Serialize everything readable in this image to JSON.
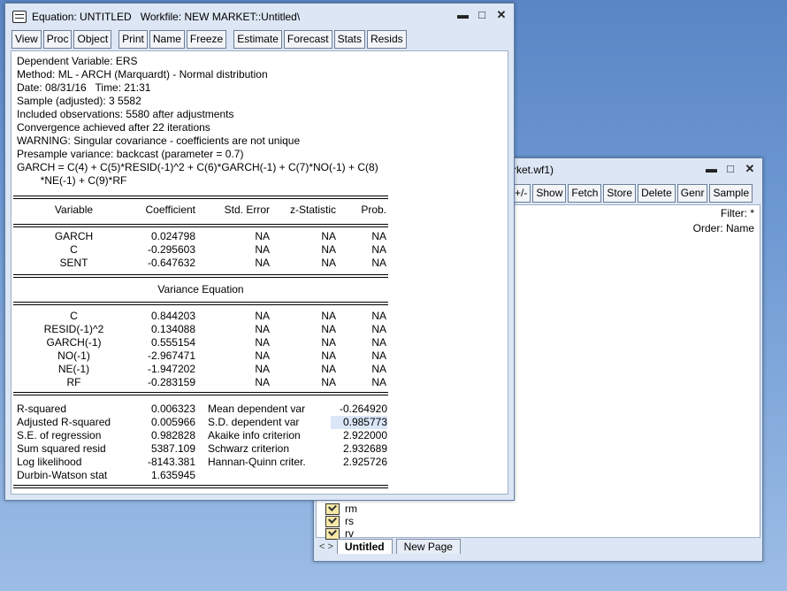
{
  "equation_window": {
    "title": "Equation: UNTITLED   Workfile: NEW MARKET::Untitled\\",
    "toolbar": [
      "View",
      "Proc",
      "Object",
      "Print",
      "Name",
      "Freeze",
      "Estimate",
      "Forecast",
      "Stats",
      "Resids"
    ],
    "header_lines": [
      "Dependent Variable: ERS",
      "Method: ML - ARCH (Marquardt) - Normal distribution",
      "Date: 08/31/16   Time: 21:31",
      "Sample (adjusted): 3 5582",
      "Included observations: 5580 after adjustments",
      "Convergence achieved after 22 iterations",
      "WARNING: Singular covariance - coefficients are not unique",
      "Presample variance: backcast (parameter = 0.7)",
      "GARCH = C(4) + C(5)*RESID(-1)^2 + C(6)*GARCH(-1) + C(7)*NO(-1) + C(8)",
      "        *NE(-1) + C(9)*RF"
    ],
    "columns": [
      "Variable",
      "Coefficient",
      "Std. Error",
      "z-Statistic",
      "Prob."
    ],
    "mean_rows": [
      [
        "GARCH",
        "0.024798",
        "NA",
        "NA",
        "NA"
      ],
      [
        "C",
        "-0.295603",
        "NA",
        "NA",
        "NA"
      ],
      [
        "SENT",
        "-0.647632",
        "NA",
        "NA",
        "NA"
      ]
    ],
    "variance_title": "Variance Equation",
    "variance_rows": [
      [
        "C",
        "0.844203",
        "NA",
        "NA",
        "NA"
      ],
      [
        "RESID(-1)^2",
        "0.134088",
        "NA",
        "NA",
        "NA"
      ],
      [
        "GARCH(-1)",
        "0.555154",
        "NA",
        "NA",
        "NA"
      ],
      [
        "NO(-1)",
        "-2.967471",
        "NA",
        "NA",
        "NA"
      ],
      [
        "NE(-1)",
        "-1.947202",
        "NA",
        "NA",
        "NA"
      ],
      [
        "RF",
        "-0.283159",
        "NA",
        "NA",
        "NA"
      ]
    ],
    "stats_rows": [
      [
        "R-squared",
        "0.006323",
        "Mean dependent var",
        "-0.264920"
      ],
      [
        "Adjusted R-squared",
        "0.005966",
        "S.D. dependent var",
        "0.985773"
      ],
      [
        "S.E. of regression",
        "0.982828",
        "Akaike info criterion",
        "2.922000"
      ],
      [
        "Sum squared resid",
        "5387.109",
        "Schwarz criterion",
        "2.932689"
      ],
      [
        "Log likelihood",
        "-8143.381",
        "Hannan-Quinn criter.",
        "2.925726"
      ],
      [
        "Durbin-Watson stat",
        "1.635945",
        "",
        ""
      ]
    ]
  },
  "workfile_window": {
    "title_fragment": "rket.wf1)",
    "toolbar": [
      "+/-",
      "Show",
      "Fetch",
      "Store",
      "Delete",
      "Genr",
      "Sample"
    ],
    "filter": "Filter: *",
    "order": "Order: Name",
    "items": [
      "rm",
      "rs",
      "rv"
    ],
    "tabs": [
      "Untitled",
      "New Page"
    ]
  }
}
